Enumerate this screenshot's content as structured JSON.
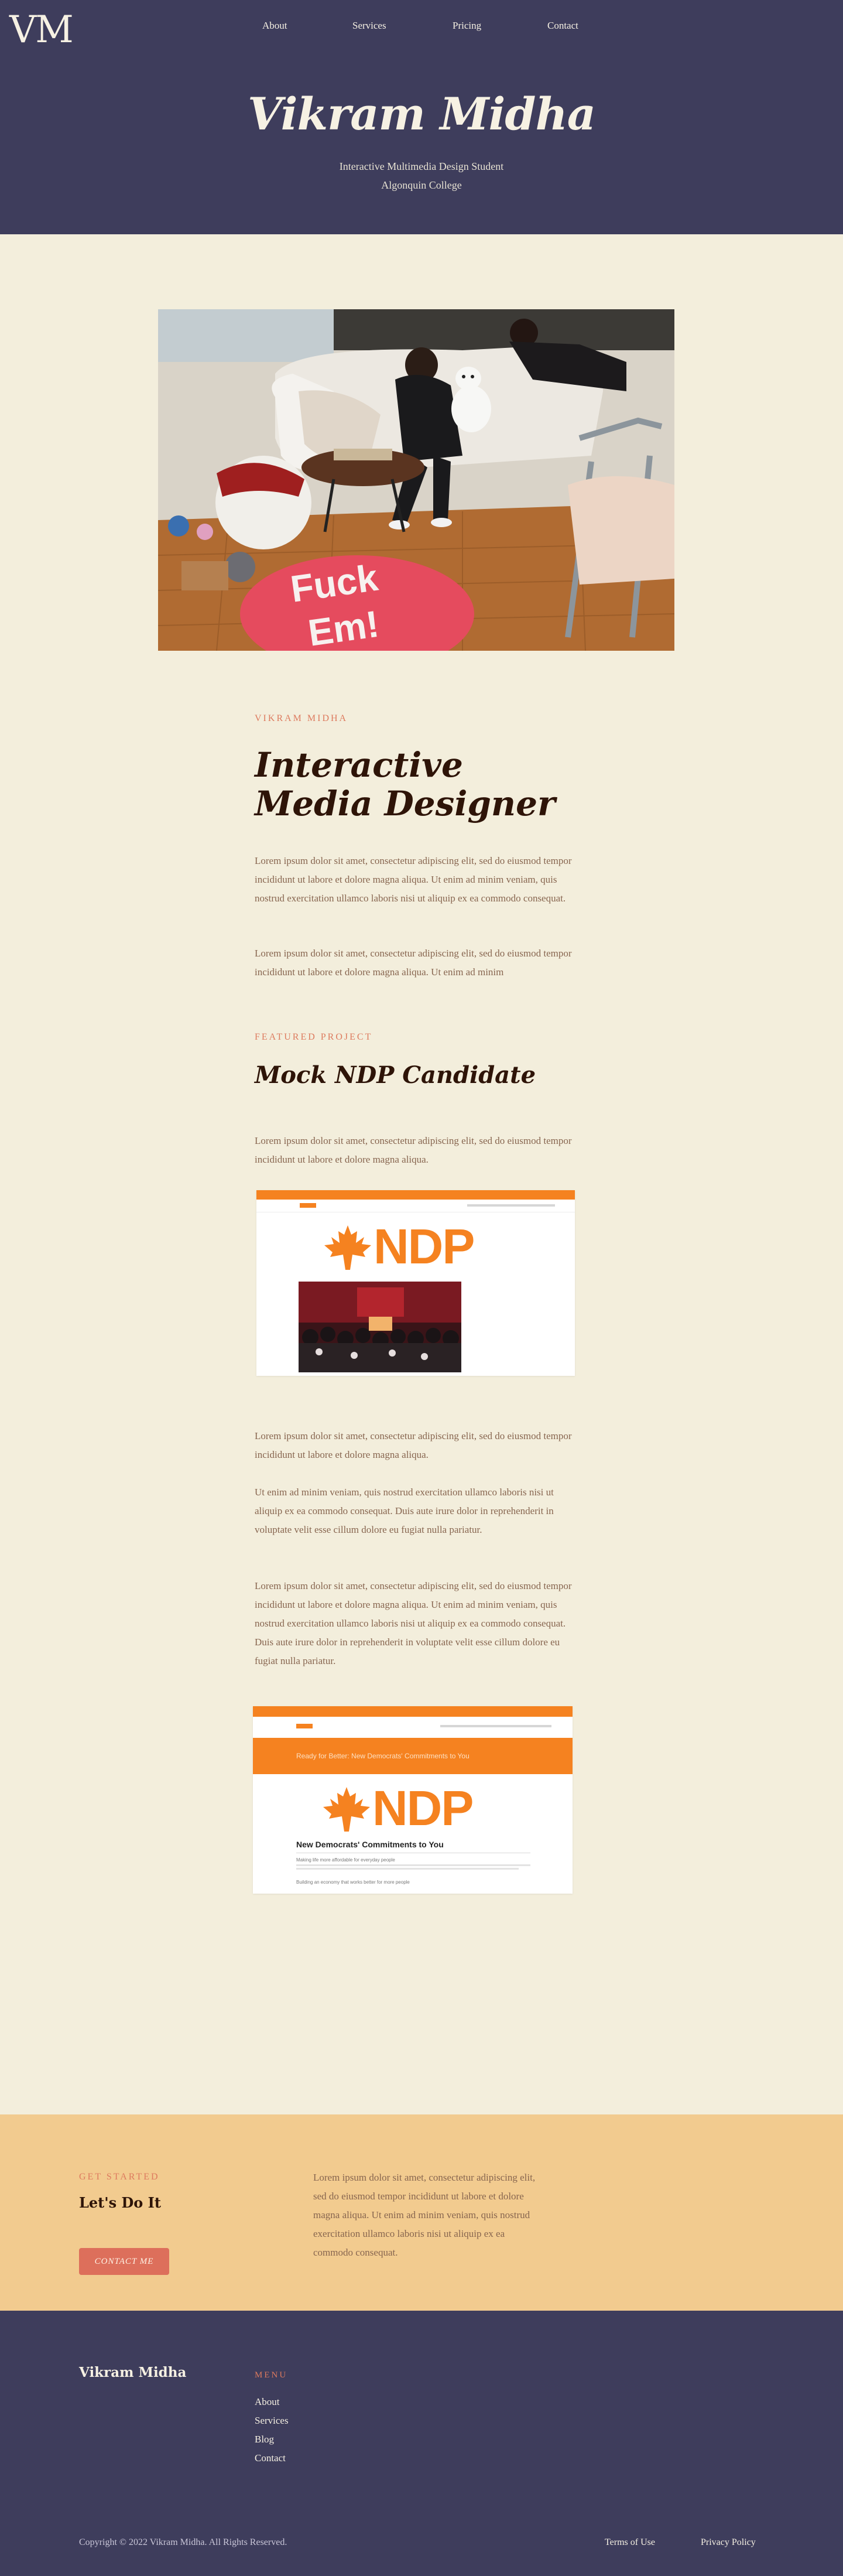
{
  "header": {
    "logo": "VM",
    "nav": [
      "About",
      "Services",
      "Pricing",
      "Contact"
    ],
    "title": "Vikram Midha",
    "subtitle_line1": "Interactive Multimedia Design Student",
    "subtitle_line2": "Algonquin College"
  },
  "intro": {
    "eyebrow": "VIKRAM MIDHA",
    "heading": "Interactive Media Designer",
    "para1": "Lorem ipsum dolor sit amet, consectetur adipiscing elit, sed do eiusmod tempor incididunt ut labore et dolore magna aliqua. Ut enim ad minim veniam, quis nostrud exercitation ullamco laboris nisi ut aliquip ex ea commodo consequat.",
    "para2": "Lorem ipsum dolor sit amet, consectetur adipiscing elit, sed do eiusmod tempor incididunt ut labore et dolore magna aliqua. Ut enim ad minim"
  },
  "project": {
    "eyebrow": "FEATURED PROJECT",
    "heading": "Mock NDP Candidate",
    "para1": "Lorem ipsum dolor sit amet, consectetur adipiscing elit, sed do eiusmod tempor incididunt ut labore et dolore magna aliqua.",
    "para2": "Lorem ipsum dolor sit amet, consectetur adipiscing elit, sed do eiusmod tempor incididunt ut labore et dolore magna aliqua.",
    "para3": "Ut enim ad minim veniam, quis nostrud exercitation ullamco laboris nisi ut aliquip ex ea commodo consequat. Duis aute irure dolor in reprehenderit in voluptate velit esse cillum dolore eu fugiat nulla pariatur.",
    "para4": "Lorem ipsum dolor sit amet, consectetur adipiscing elit, sed do eiusmod tempor incididunt ut labore et dolore magna aliqua. Ut enim ad minim veniam, quis nostrud exercitation ullamco laboris nisi ut aliquip ex ea commodo consequat. Duis aute irure dolor in reprehenderit in voluptate velit esse cillum dolore eu fugiat nulla pariatur.",
    "shot1_logo": "NDP",
    "shot2_logo": "NDP",
    "shot2_banner": "Ready for Better: New Democrats' Commitments to You",
    "shot2_heading": "New Democrats' Commitments to You",
    "shot2_item1": "Making life more affordable for everyday people",
    "shot2_item2": "Building an economy that works better for more people",
    "accent": "#f58220"
  },
  "cta": {
    "eyebrow": "GET STARTED",
    "title": "Let's Do It",
    "button": "CONTACT ME",
    "text": "Lorem ipsum dolor sit amet, consectetur adipiscing elit, sed do eiusmod tempor incididunt ut labore et dolore magna aliqua. Ut enim ad minim veniam, quis nostrud exercitation ullamco laboris nisi ut aliquip ex ea commodo consequat."
  },
  "footer": {
    "brand": "Vikram Midha",
    "menu_title": "MENU",
    "menu": [
      "About",
      "Services",
      "Blog",
      "Contact"
    ],
    "copyright": "Copyright © 2022 Vikram Midha. All Rights Reserved.",
    "terms": "Terms of Use",
    "privacy": "Privacy Policy"
  },
  "colors": {
    "navy": "#3e3d5c",
    "cream": "#f3eedc",
    "coral": "#dd7a5e",
    "sand": "#f2cb8f"
  }
}
